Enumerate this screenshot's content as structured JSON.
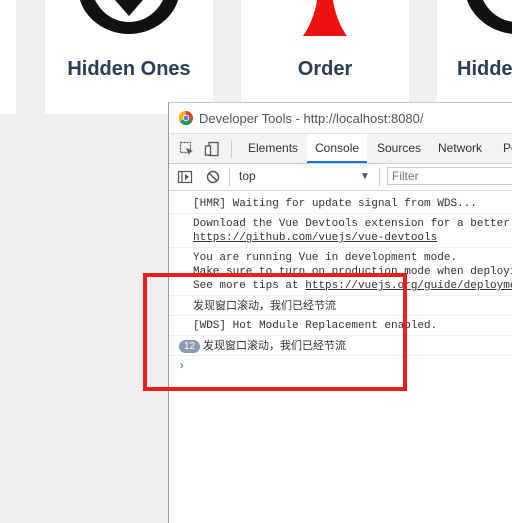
{
  "background": {
    "cards": [
      {
        "title": ""
      },
      {
        "title": "Hidden Ones",
        "icon": "hidden-ones-emblem-icon"
      },
      {
        "title": "Order",
        "icon": "order-emblem-icon"
      },
      {
        "title": "Hidde",
        "icon": "hidden-ones-emblem-icon"
      }
    ]
  },
  "devtools": {
    "window_title": "Developer Tools - http://localhost:8080/",
    "tabs": [
      "Elements",
      "Console",
      "Sources",
      "Network",
      "Pe"
    ],
    "active_tab": "Console",
    "context": "top",
    "filter_placeholder": "Filter",
    "messages": [
      {
        "lines": [
          "[HMR] Waiting for update signal from WDS..."
        ]
      },
      {
        "lines": [
          "Download the Vue Devtools extension for a better"
        ],
        "link": "https://github.com/vuejs/vue-devtools"
      },
      {
        "lines": [
          "You are running Vue in development mode.",
          "Make sure to turn on production mode when deployi"
        ],
        "tail_prefix": "See more tips at ",
        "tail_link": "https://vuejs.org/guide/deployme"
      },
      {
        "lines": [
          "发现窗口滚动，我们已经节流"
        ]
      },
      {
        "lines": [
          "[WDS] Hot Module Replacement enabled."
        ]
      },
      {
        "lines": [
          "发现窗口滚动，我们已经节流"
        ],
        "count": "12"
      }
    ],
    "prompt_symbol": "›"
  },
  "colors": {
    "highlight": "#ee1c1c",
    "order_red": "#ee1111",
    "active_tab": "#1a73e8"
  }
}
